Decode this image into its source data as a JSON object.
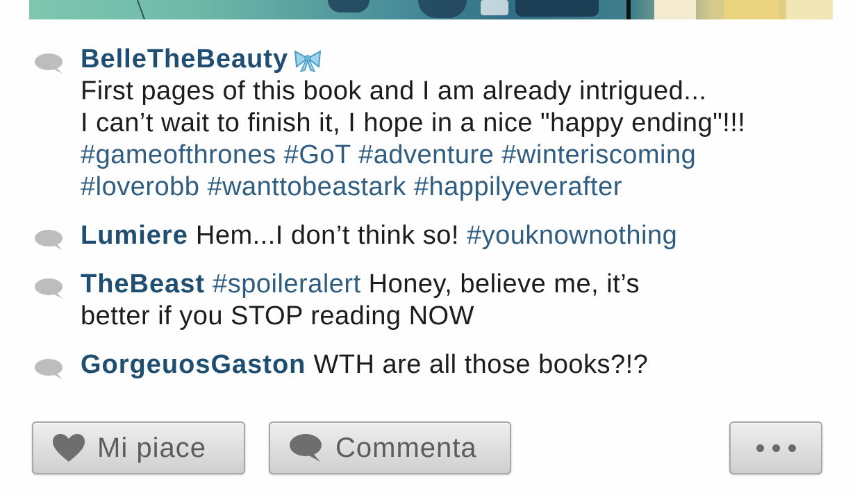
{
  "comments": [
    {
      "user": "BelleTheBeauty",
      "line1": "First pages of this book and I am already intrigued...",
      "line2": "I can’t wait to finish it, I hope in a nice \"happy ending\"!!!",
      "line3": "#gameofthrones #GoT #adventure #winteriscoming",
      "line4": "#loverobb #wanttobeastark #happilyeverafter",
      "badge_icon": "ribbon-bow-icon"
    },
    {
      "user": "Lumiere",
      "text": "Hem...I don’t think so! ",
      "tag": "#youknownothing"
    },
    {
      "user": "TheBeast",
      "tag": "#spoileralert",
      "text": " Honey, believe me, it’s",
      "text2": "better if you STOP reading NOW"
    },
    {
      "user": "GorgeuosGaston",
      "text": "WTH are all those books?!?"
    }
  ],
  "actions": {
    "like_label": "Mi piace",
    "comment_label": "Commenta",
    "like_icon": "heart-icon",
    "comment_icon": "speech-bubble-icon",
    "more_icon": "more-dots-icon"
  },
  "colors": {
    "username": "#1f4e73",
    "hashtag": "#2f5d81",
    "text": "#1c1c1c",
    "button_text": "#5c5c5c"
  }
}
